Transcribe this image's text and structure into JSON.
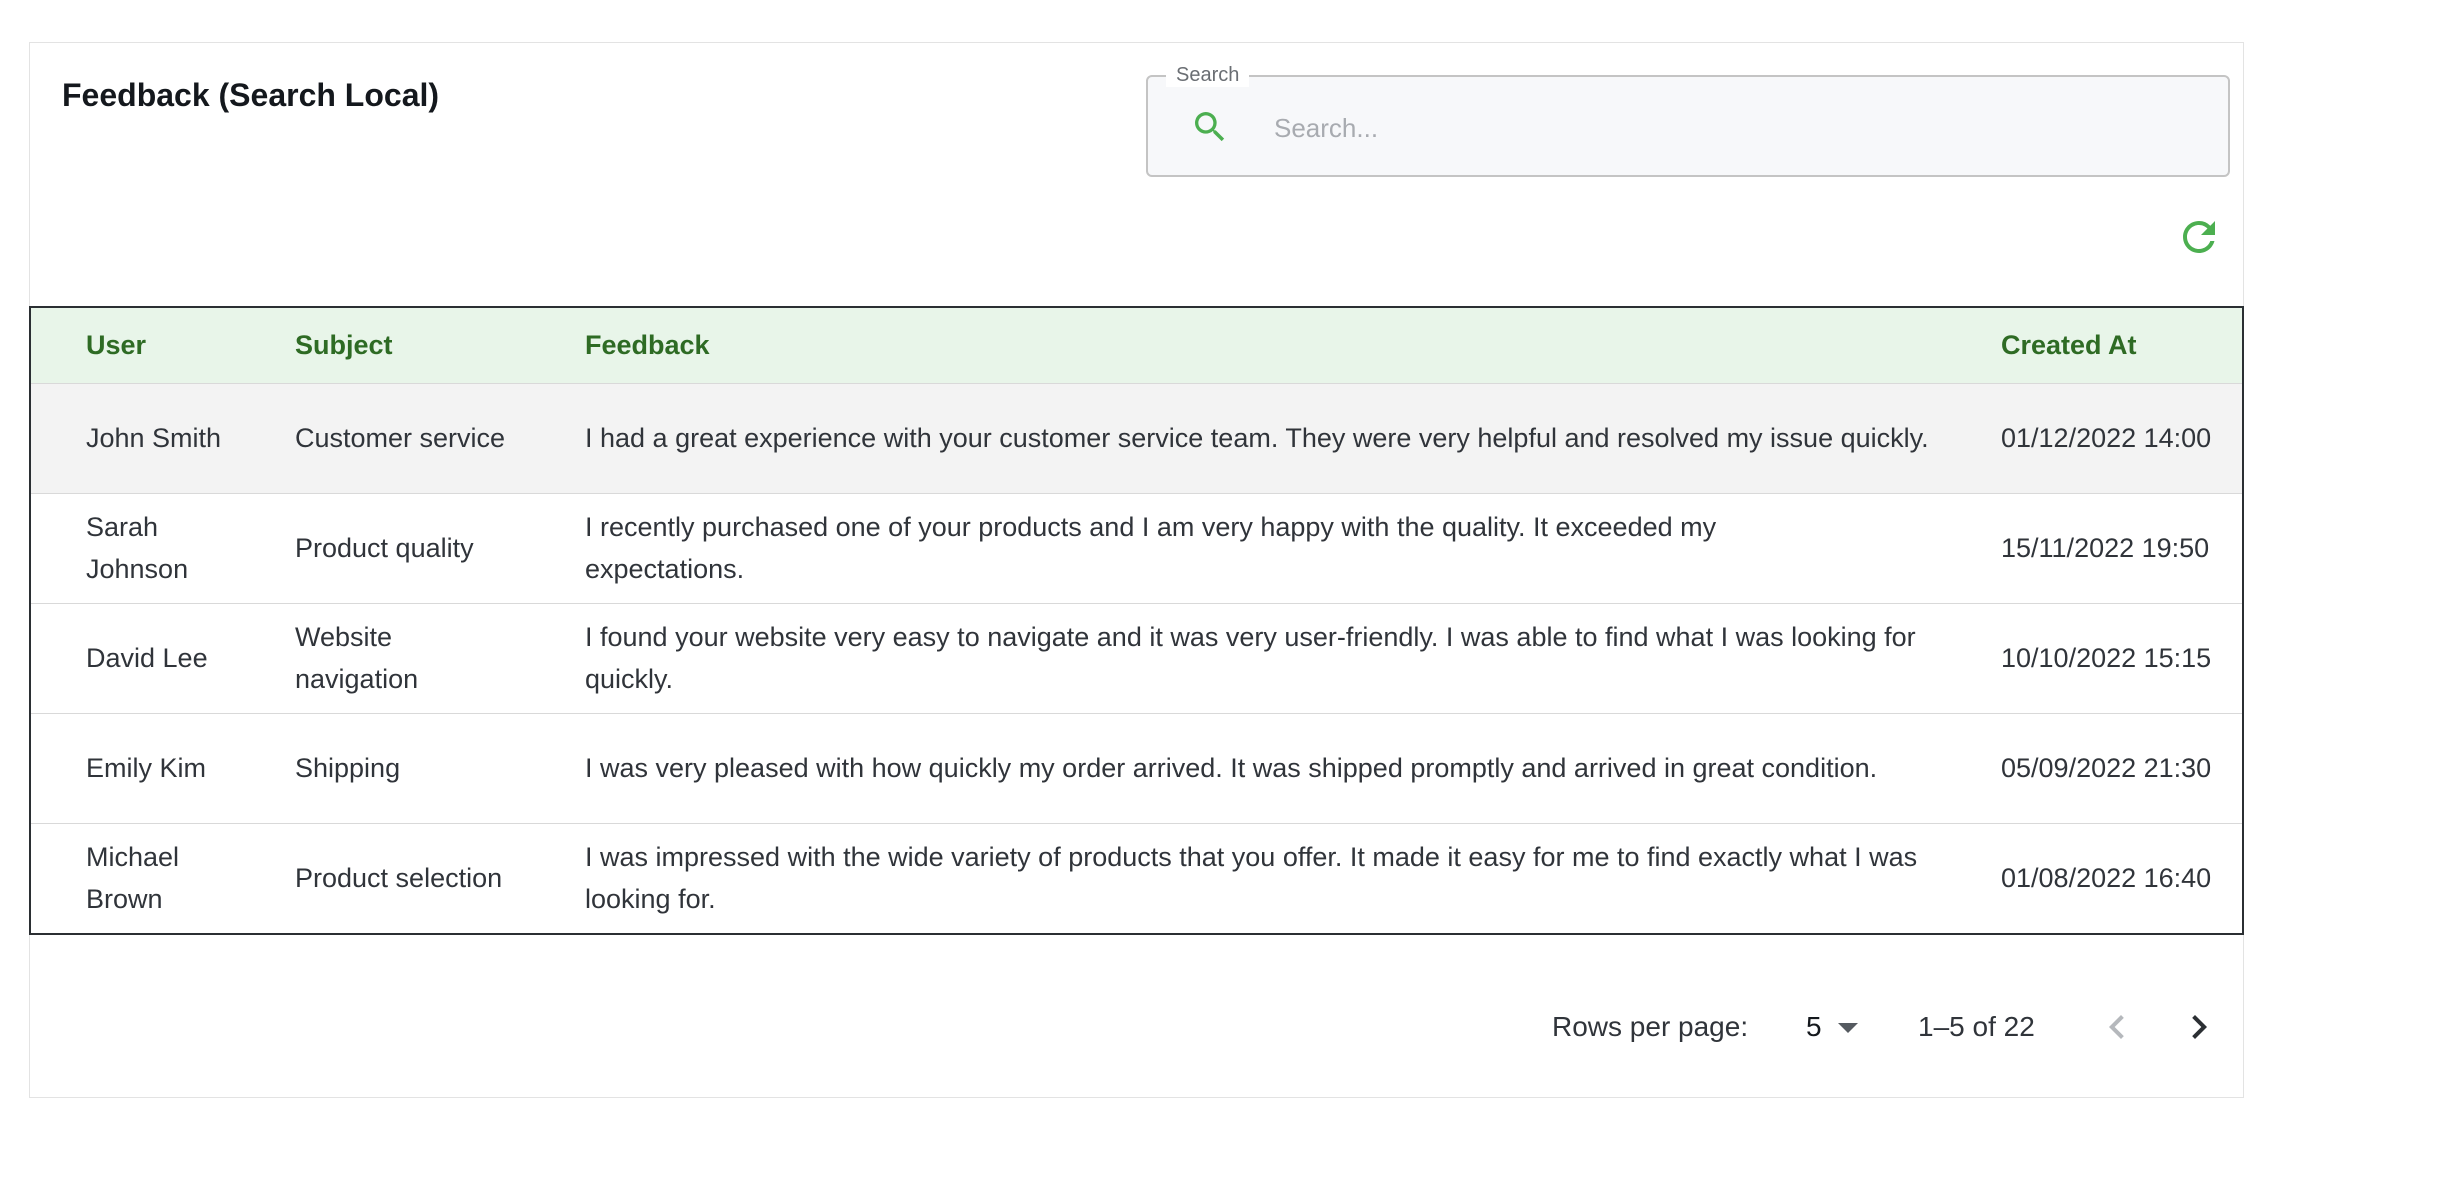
{
  "header": {
    "title": "Feedback (Search Local)"
  },
  "search": {
    "label": "Search",
    "placeholder": "Search...",
    "value": ""
  },
  "colors": {
    "accent": "#4caf50",
    "header_bg": "#e8f5e9",
    "header_text": "#2e6b24"
  },
  "icons": {
    "search": "search-icon",
    "refresh": "refresh-icon",
    "caret": "caret-down-icon",
    "prev": "chevron-left-icon",
    "next": "chevron-right-icon"
  },
  "table": {
    "columns": {
      "user": "User",
      "subject": "Subject",
      "feedback": "Feedback",
      "created_at": "Created At"
    },
    "rows": [
      {
        "user": "John Smith",
        "subject": "Customer service",
        "feedback": "I had a great experience with your customer service team. They were very helpful and resolved my issue quickly.",
        "created_at": "01/12/2022 14:00"
      },
      {
        "user": "Sarah Johnson",
        "subject": "Product quality",
        "feedback": "I recently purchased one of your products and I am very happy with the quality. It exceeded my expectations.",
        "created_at": "15/11/2022 19:50"
      },
      {
        "user": "David Lee",
        "subject": "Website navigation",
        "feedback": "I found your website very easy to navigate and it was very user-friendly. I was able to find what I was looking for quickly.",
        "created_at": "10/10/2022 15:15"
      },
      {
        "user": "Emily Kim",
        "subject": "Shipping",
        "feedback": "I was very pleased with how quickly my order arrived. It was shipped promptly and arrived in great condition.",
        "created_at": "05/09/2022 21:30"
      },
      {
        "user": "Michael Brown",
        "subject": "Product selection",
        "feedback": "I was impressed with the wide variety of products that you offer. It made it easy for me to find exactly what I was looking for.",
        "created_at": "01/08/2022 16:40"
      }
    ]
  },
  "pagination": {
    "rows_per_page_label": "Rows per page:",
    "rows_per_page": "5",
    "range": "1–5 of 22"
  }
}
